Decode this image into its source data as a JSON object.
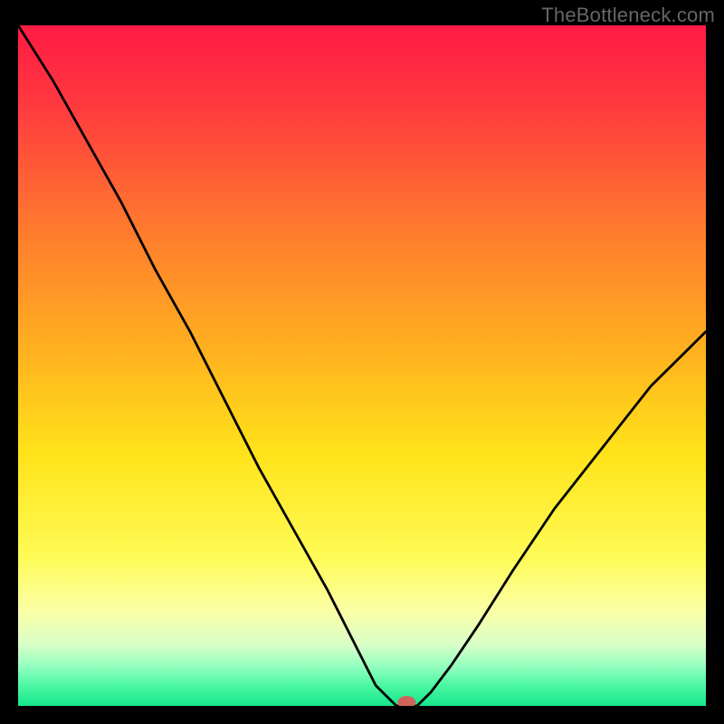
{
  "watermark": "TheBottleneck.com",
  "chart_data": {
    "type": "line",
    "title": "",
    "xlabel": "",
    "ylabel": "",
    "xlim": [
      0,
      100
    ],
    "ylim": [
      0,
      100
    ],
    "grid": false,
    "series": [
      {
        "name": "bottleneck-curve",
        "x": [
          0,
          5,
          10,
          15,
          20,
          25,
          30,
          35,
          40,
          45,
          50,
          52,
          55,
          58,
          60,
          63,
          67,
          72,
          78,
          85,
          92,
          100
        ],
        "values": [
          100,
          92,
          83,
          74,
          64,
          55,
          45,
          35,
          26,
          17,
          7,
          3,
          0,
          0,
          2,
          6,
          12,
          20,
          29,
          38,
          47,
          55
        ]
      }
    ],
    "marker": {
      "x": 56.5,
      "y": 0,
      "color": "#d1645a"
    },
    "gradient_stops": [
      {
        "offset": 0.0,
        "color": "#ff1a44"
      },
      {
        "offset": 0.12,
        "color": "#ff3a3f"
      },
      {
        "offset": 0.3,
        "color": "#ff7a2e"
      },
      {
        "offset": 0.48,
        "color": "#ffb21f"
      },
      {
        "offset": 0.63,
        "color": "#ffe31a"
      },
      {
        "offset": 0.78,
        "color": "#fffb55"
      },
      {
        "offset": 0.86,
        "color": "#fbffa5"
      },
      {
        "offset": 0.91,
        "color": "#d9ffc8"
      },
      {
        "offset": 0.94,
        "color": "#98ffc0"
      },
      {
        "offset": 0.97,
        "color": "#4cf7a2"
      },
      {
        "offset": 1.0,
        "color": "#14e78a"
      }
    ]
  }
}
